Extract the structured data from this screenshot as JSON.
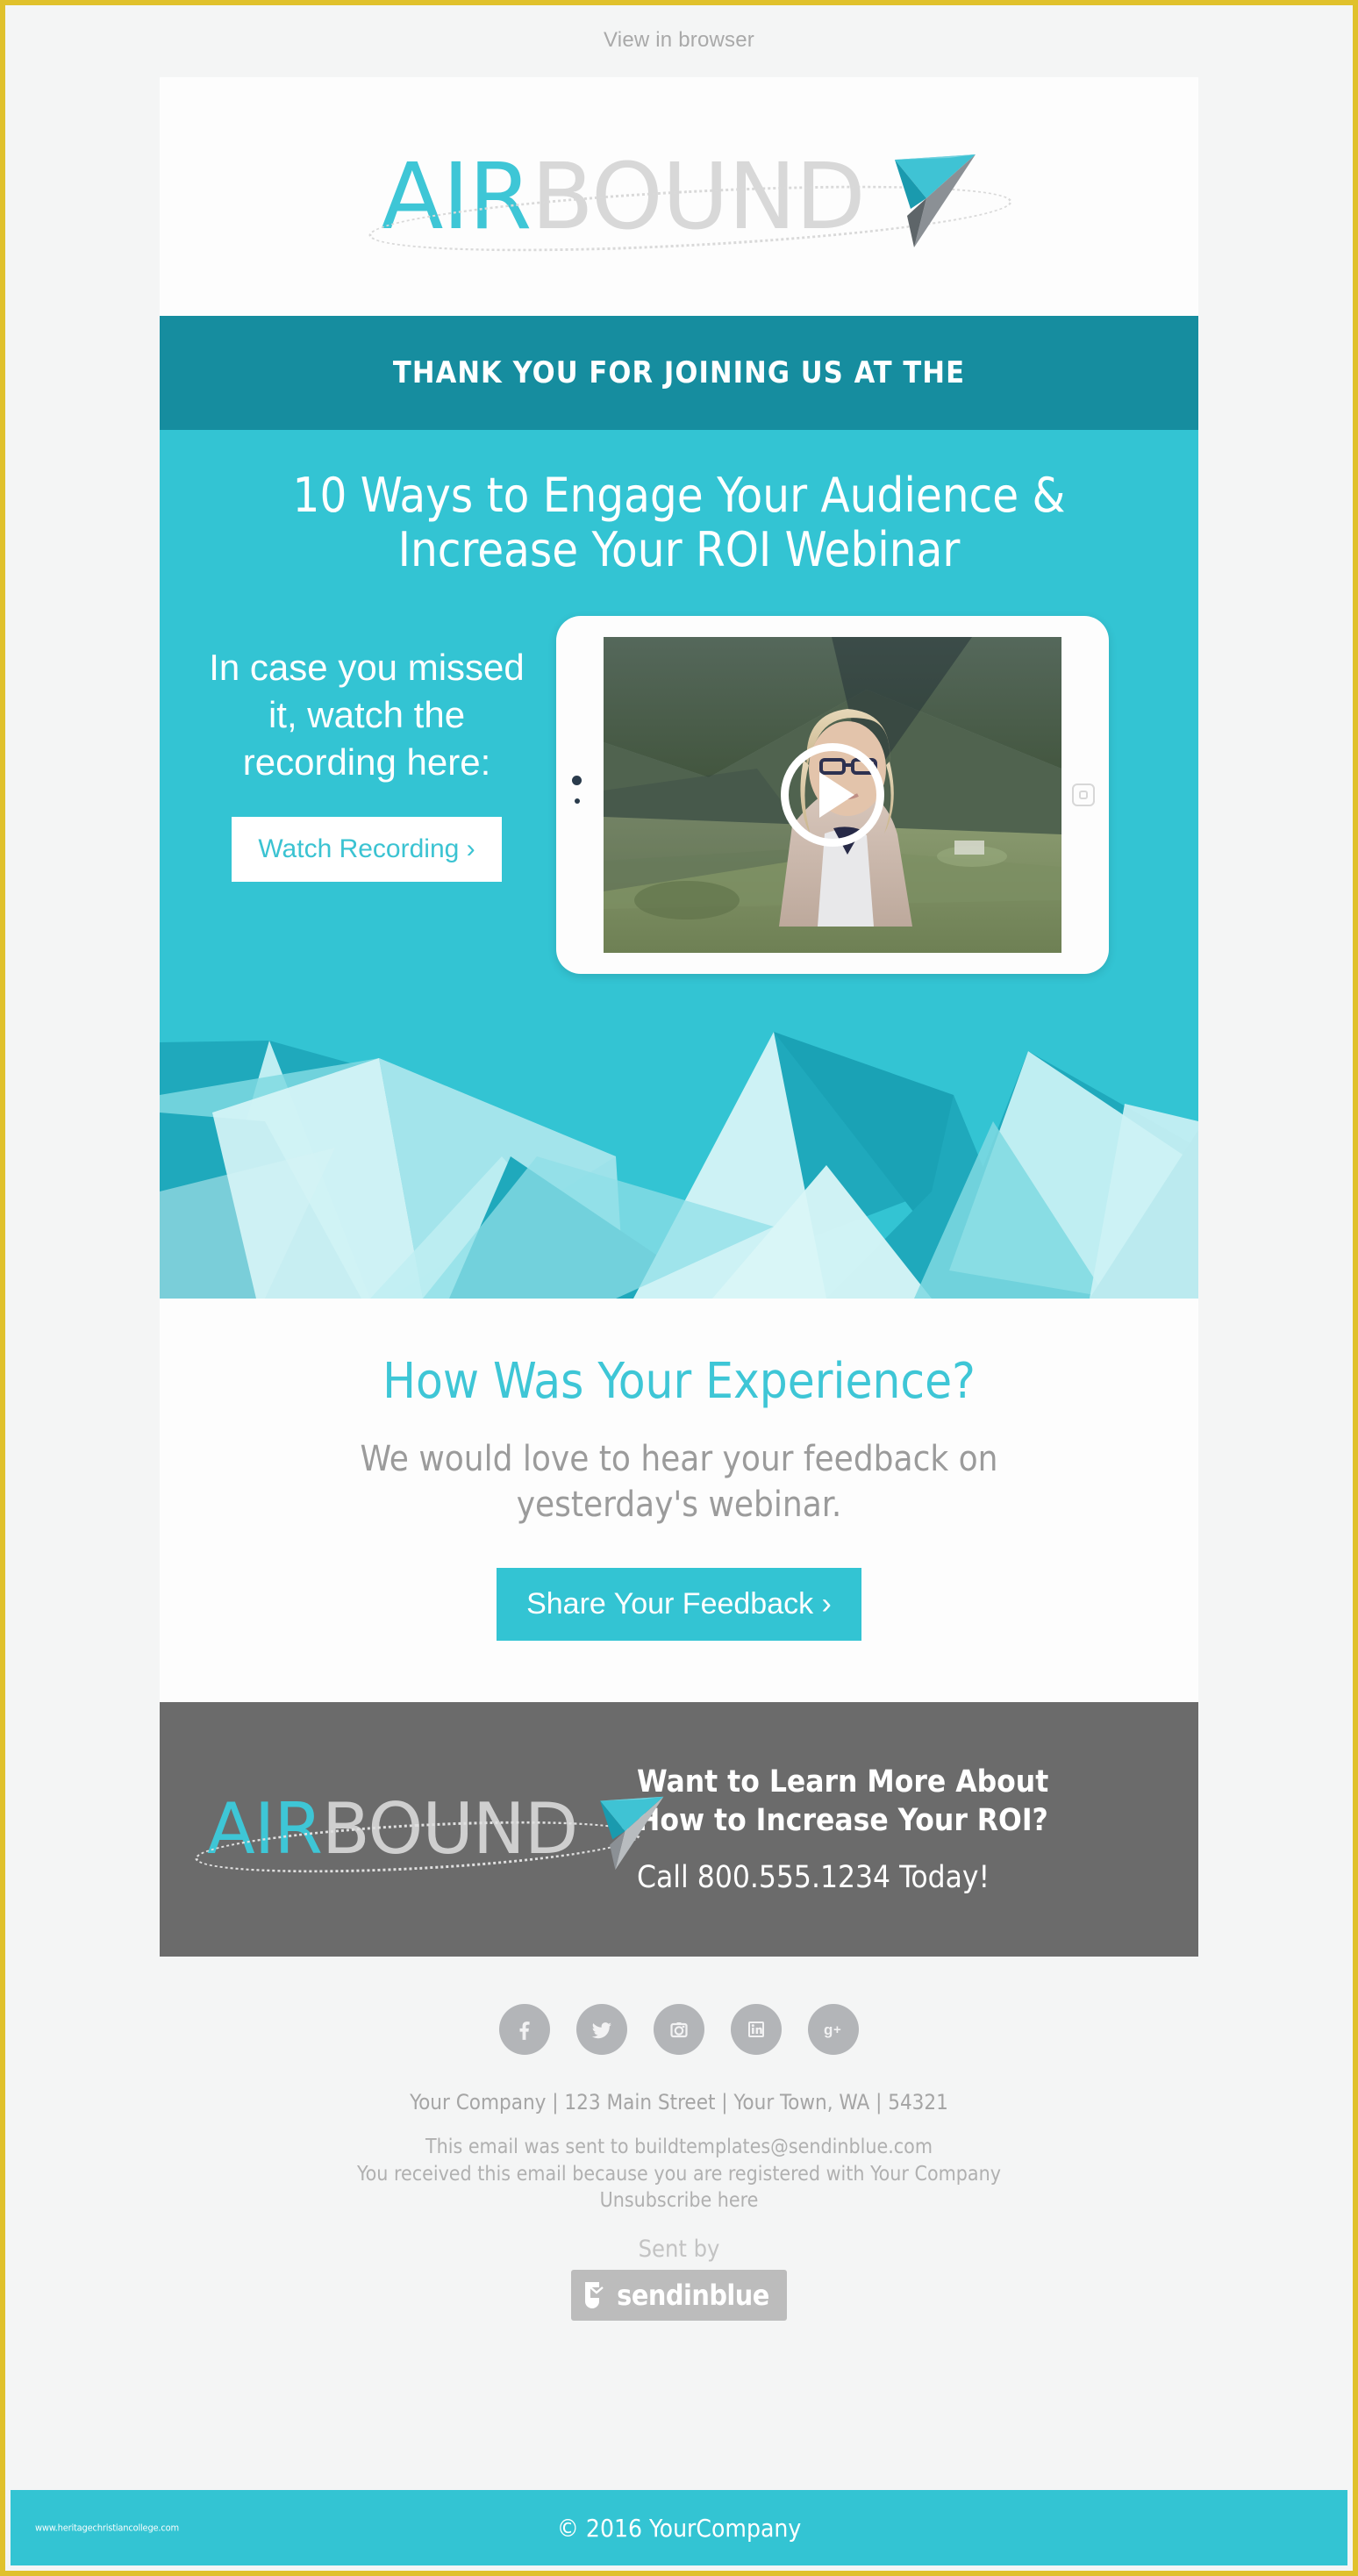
{
  "theme": {
    "page_border": "#E0C12C",
    "page_bg": "#F4F5F5",
    "teal_dark": "#168D9F",
    "teal": "#33C4D3",
    "teal_light": "#3EC6D6",
    "gray_cta": "#6B6B6B",
    "body_gray": "#9B9B9B",
    "white": "#FFFFFF"
  },
  "preheader": {
    "view_in_browser": "View in browser"
  },
  "logo": {
    "part_one": "AIR",
    "part_two": "BOUND",
    "icon": "paper-plane-icon"
  },
  "banner": {
    "eyebrow": "THANK YOU FOR JOINING US AT THE"
  },
  "hero": {
    "headline": "10 Ways to Engage Your Audience & Increase Your ROI Webinar",
    "side_copy": "In case you missed it, watch the recording here:",
    "watch_button": "Watch Recording ›",
    "video": {
      "alt": "Webinar recording thumbnail: woman outdoors with mountain background",
      "play_icon": "play-icon",
      "device": "tablet"
    }
  },
  "feedback": {
    "heading": "How Was Your Experience?",
    "body": "We would love to hear your feedback on yesterday's webinar.",
    "button": "Share Your Feedback ›"
  },
  "cta": {
    "line1": "Want to Learn More About",
    "line2": "How to Increase Your ROI?",
    "line3": "Call 800.555.1234 Today!"
  },
  "social": [
    {
      "name": "facebook",
      "icon": "facebook-icon",
      "label": "f"
    },
    {
      "name": "twitter",
      "icon": "twitter-icon",
      "label": "t"
    },
    {
      "name": "instagram",
      "icon": "instagram-icon",
      "label": "ig"
    },
    {
      "name": "linkedin",
      "icon": "linkedin-icon",
      "label": "in"
    },
    {
      "name": "googleplus",
      "icon": "google-plus-icon",
      "label": "g+"
    }
  ],
  "footer": {
    "address": "Your Company  |  123 Main Street  |  Your Town, WA  |  54321",
    "sent_to": "This email was sent to buildtemplates@sendinblue.com",
    "registered": "You received this email because you are registered with Your Company",
    "unsubscribe": "Unsubscribe here",
    "sent_by": "Sent by",
    "provider": "sendinblue"
  },
  "bottom": {
    "copyright": "© 2016 YourCompany",
    "watermark": "www.heritagechristiancollege.com"
  }
}
